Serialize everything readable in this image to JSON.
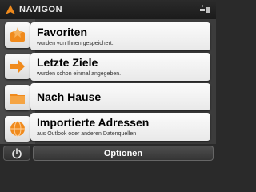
{
  "app": {
    "brand": "NAVIGON"
  },
  "icons": {
    "brand": "navigon-arrow-icon",
    "gps": "gps-satellite-icon",
    "favorites": "star-folder-icon",
    "recent": "orange-arrow-icon",
    "home": "folder-home-icon",
    "import": "globe-import-icon",
    "power": "power-icon"
  },
  "menu": {
    "items": [
      {
        "title": "Favoriten",
        "subtitle": "wurden von Ihnen gespeichert."
      },
      {
        "title": "Letzte Ziele",
        "subtitle": "wurden schon einmal angegeben."
      },
      {
        "title": "Nach Hause",
        "subtitle": ""
      },
      {
        "title": "Importierte Adressen",
        "subtitle": "aus Outlook oder anderen Datenquellen"
      }
    ]
  },
  "bottom": {
    "options_label": "Optionen"
  },
  "colors": {
    "accent": "#f08a1c",
    "background": "#3c3c3c",
    "item_bg": "#f2f2f2"
  }
}
